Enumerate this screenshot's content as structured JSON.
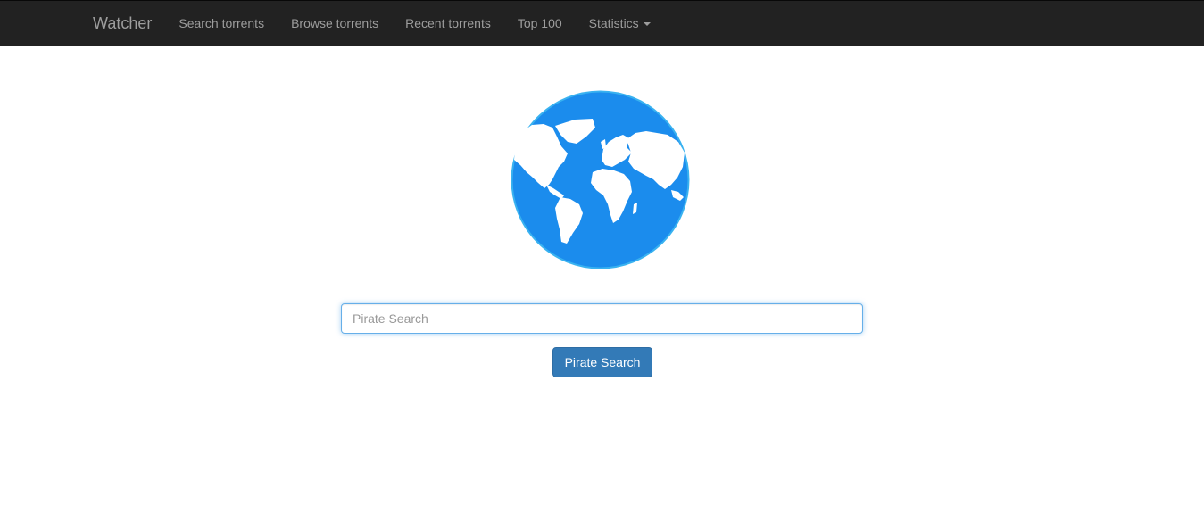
{
  "navbar": {
    "brand": "Watcher",
    "items": [
      {
        "label": "Search torrents"
      },
      {
        "label": "Browse torrents"
      },
      {
        "label": "Recent torrents"
      },
      {
        "label": "Top 100"
      },
      {
        "label": "Statistics",
        "dropdown": true
      }
    ]
  },
  "logo": {
    "icon": "globe-icon",
    "ocean_color": "#1b8ced",
    "land_color": "#ffffff"
  },
  "search": {
    "value": "",
    "placeholder": "Pirate Search",
    "button_label": "Pirate Search",
    "button_color": "#337ab7"
  },
  "colors": {
    "navbar_bg": "#222222",
    "navbar_text": "#9d9d9d",
    "focus_border": "#66afe9"
  }
}
